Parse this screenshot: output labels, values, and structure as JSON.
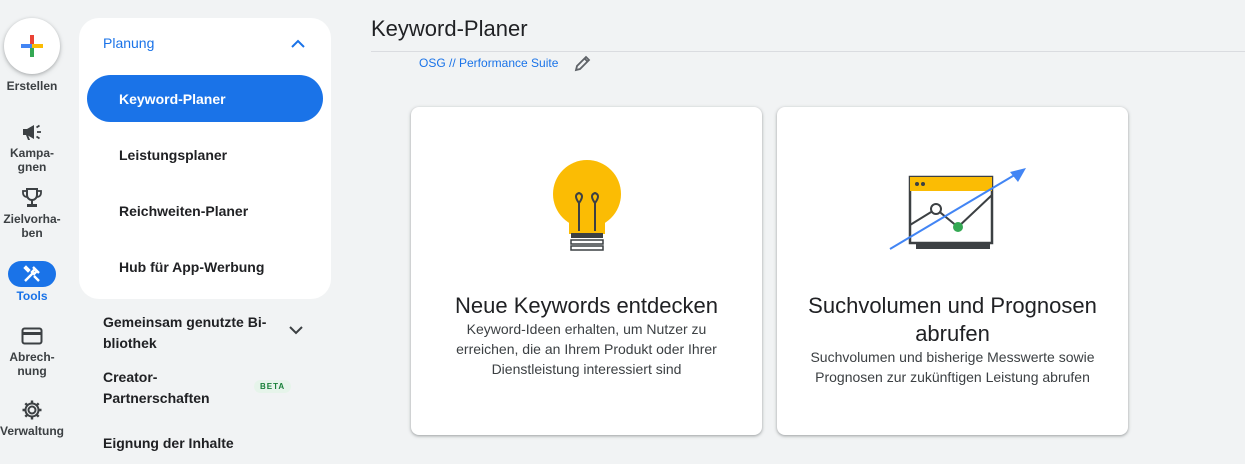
{
  "rail": {
    "create_label": "Erstellen",
    "items": [
      {
        "label_1": "Kampa-",
        "label_2": "gnen",
        "icon": "megaphone-icon"
      },
      {
        "label_1": "Zielvorha-",
        "label_2": "ben",
        "icon": "trophy-icon"
      },
      {
        "label_1": "Tools",
        "label_2": "",
        "icon": "tools-icon"
      },
      {
        "label_1": "Abrech-",
        "label_2": "nung",
        "icon": "credit-card-icon"
      },
      {
        "label_1": "Verwaltung",
        "label_2": "",
        "icon": "gear-icon"
      }
    ]
  },
  "subnav": {
    "section": "Planung",
    "items": [
      "Keyword-Planer",
      "Leistungsplaner",
      "Reichweiten-Planer",
      "Hub für App-Werbung"
    ],
    "more": [
      {
        "line1": "Gemeinsam genutzte Bi-",
        "line2": "bliothek"
      },
      {
        "line1": "Creator-",
        "line2": "Partnerschaften"
      },
      {
        "line1": "Eignung der Inhalte",
        "line2": ""
      }
    ],
    "beta_badge": "BETA"
  },
  "header": {
    "title": "Keyword-Planer",
    "account": "OSG // Performance Suite"
  },
  "cards": [
    {
      "title": "Neue Keywords entdecken",
      "desc": "Keyword-Ideen erhalten, um Nutzer zu erreichen, die an Ihrem Produkt oder Ihrer Dienstleistung interessiert sind",
      "icon": "lightbulb-icon"
    },
    {
      "title": "Suchvolumen und Prognosen abrufen",
      "desc": "Suchvolumen und bisherige Messwerte sowie Prognosen zur zukünftigen Leistung abrufen",
      "icon": "trend-chart-icon"
    }
  ],
  "colors": {
    "accent": "#1a73e8",
    "bulb": "#fbbc04",
    "green": "#34a853"
  }
}
